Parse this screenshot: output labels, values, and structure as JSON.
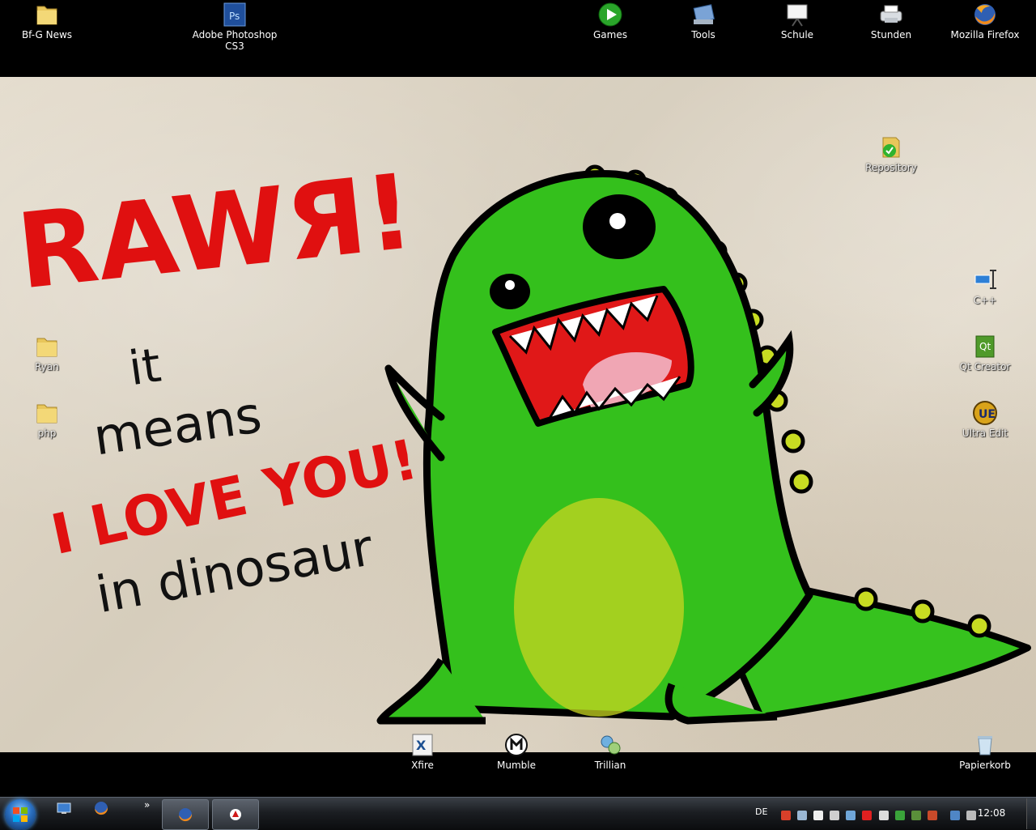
{
  "desktop": {
    "top_icons": [
      {
        "label": "Bf-G News",
        "icon": "folder-icon"
      },
      {
        "label": "Adobe Photoshop\nCS3",
        "icon": "photoshop-icon"
      },
      {
        "label": "Games",
        "icon": "games-icon"
      },
      {
        "label": "Tools",
        "icon": "tools-icon"
      },
      {
        "label": "Schule",
        "icon": "schule-icon"
      },
      {
        "label": "Stunden",
        "icon": "stunden-icon"
      },
      {
        "label": "Mozilla Firefox",
        "icon": "firefox-icon"
      }
    ],
    "left_icons": [
      {
        "label": "Ryan",
        "icon": "folder-icon"
      },
      {
        "label": "php",
        "icon": "folder-icon"
      }
    ],
    "right_icons": [
      {
        "label": "Repository",
        "icon": "repository-icon"
      },
      {
        "label": "C++",
        "icon": "cpp-icon"
      },
      {
        "label": "Qt Creator",
        "icon": "qt-creator-icon"
      },
      {
        "label": "Ultra Edit",
        "icon": "ultraedit-icon"
      }
    ],
    "bottom_icons": [
      {
        "label": "Xfire",
        "icon": "xfire-icon"
      },
      {
        "label": "Mumble",
        "icon": "mumble-icon"
      },
      {
        "label": "Trillian",
        "icon": "trillian-icon"
      },
      {
        "label": "Papierkorb",
        "icon": "recycle-bin-icon"
      }
    ]
  },
  "wallpaper": {
    "title": "RAWЯ!",
    "line1": "it",
    "line2": "means",
    "line3": "I LOVE YOU!",
    "line4": "in dinosaur"
  },
  "taskbar": {
    "language": "DE",
    "clock": "12:08",
    "overflow": "»"
  },
  "colors": {
    "handwriting_red": "#e01010",
    "dino_green": "#2fbf1a",
    "taskbar": "#15181c"
  }
}
